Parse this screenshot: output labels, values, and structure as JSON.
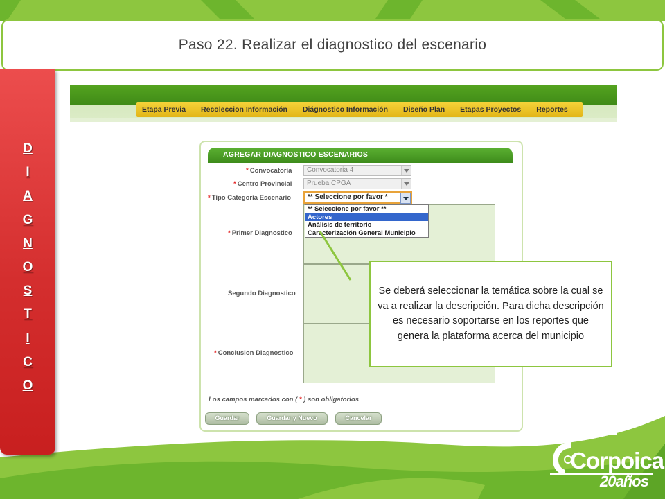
{
  "slide": {
    "title": "Paso 22. Realizar el diagnostico del escenario",
    "side_letters": [
      "D",
      "I",
      "A",
      "G",
      "N",
      "O",
      "S",
      "T",
      "I",
      "C",
      "O"
    ],
    "callout": "Se deberá seleccionar la temática sobre la cual se va a realizar la descripción. Para dicha descripción es necesario soportarse en los reportes  que genera la plataforma acerca del municipio",
    "logo_text": "Corpoica",
    "logo_sub": "20años",
    "colors": {
      "accent": "#8dc63f",
      "side_tab": "#d42e2e",
      "menu": "#f0c72a",
      "panel_header": "#4a9e25"
    }
  },
  "app": {
    "menu": [
      "Etapa Previa",
      "Recoleccion Información",
      "Diágnostico Información",
      "Diseño Plan",
      "Etapas Proyectos",
      "Reportes"
    ],
    "panel_title": "AGREGAR DIAGNOSTICO ESCENARIOS",
    "fields": {
      "convocatoria": {
        "label": "Convocatoria",
        "value": "Convocatoria 4"
      },
      "centro": {
        "label": "Centro Provincial",
        "value": "Prueba CPGA"
      },
      "tipo": {
        "label": "Tipo Categoría Escenario",
        "value": "** Seleccione por favor *"
      },
      "primer": {
        "label": "Primer Diagnostico"
      },
      "segundo": {
        "label": "Segundo Diagnostico"
      },
      "conclusion": {
        "label": "Conclusion Diagnostico"
      }
    },
    "required_mark": "*",
    "dropdown_options": [
      "** Seleccione por favor **",
      "Actores",
      "Análisis de territorio",
      "Caracterización General Municipio"
    ],
    "note": {
      "before": "Los campos marcados con (",
      "mark": " * ",
      "after": ") son obligatorios"
    },
    "buttons": {
      "save": "Guardar",
      "save_new": "Guardar y Nuevo",
      "cancel": "Cancelar"
    }
  }
}
